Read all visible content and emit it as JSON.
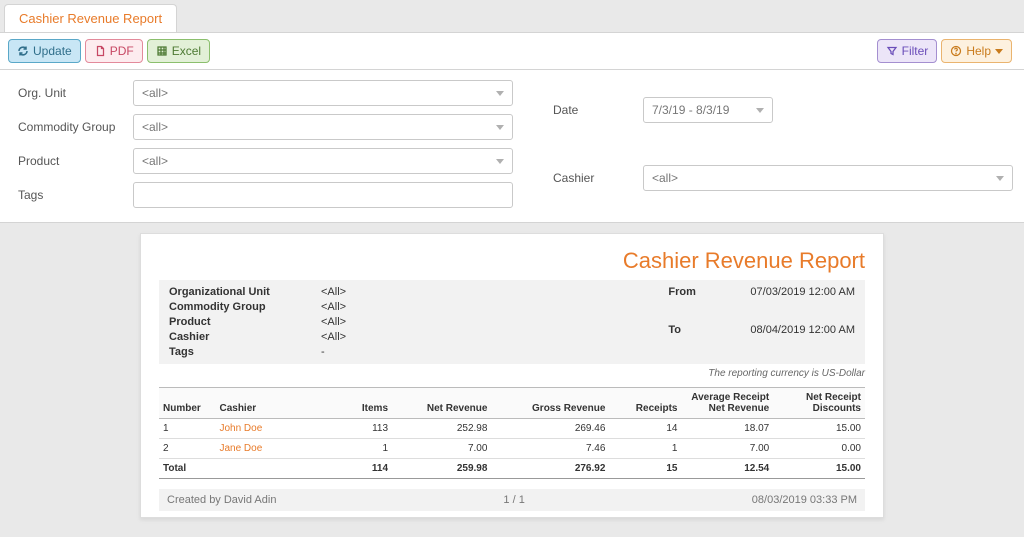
{
  "tab_title": "Cashier Revenue Report",
  "toolbar": {
    "update": "Update",
    "pdf": "PDF",
    "excel": "Excel",
    "filter": "Filter",
    "help": "Help"
  },
  "filters": {
    "org_unit_label": "Org. Unit",
    "org_unit_value": "<all>",
    "commodity_label": "Commodity Group",
    "commodity_value": "<all>",
    "product_label": "Product",
    "product_value": "<all>",
    "tags_label": "Tags",
    "tags_value": "",
    "date_label": "Date",
    "date_value": "7/3/19 - 8/3/19",
    "cashier_label": "Cashier",
    "cashier_value": "<all>"
  },
  "report": {
    "title": "Cashier Revenue Report",
    "meta": {
      "org_unit_k": "Organizational Unit",
      "org_unit_v": "<All>",
      "commodity_k": "Commodity Group",
      "commodity_v": "<All>",
      "product_k": "Product",
      "product_v": "<All>",
      "cashier_k": "Cashier",
      "cashier_v": "<All>",
      "tags_k": "Tags",
      "tags_v": "-",
      "from_k": "From",
      "from_v": "07/03/2019 12:00 AM",
      "to_k": "To",
      "to_v": "08/04/2019 12:00 AM"
    },
    "currency_note": "The reporting currency is US-Dollar",
    "columns": {
      "number": "Number",
      "cashier": "Cashier",
      "items": "Items",
      "net_rev": "Net Revenue",
      "gross_rev": "Gross Revenue",
      "receipts": "Receipts",
      "avg_receipt": "Average Receipt Net Revenue",
      "net_discounts": "Net Receipt Discounts"
    },
    "rows": [
      {
        "number": "1",
        "cashier": "John Doe",
        "items": "113",
        "net_rev": "252.98",
        "gross_rev": "269.46",
        "receipts": "14",
        "avg_receipt": "18.07",
        "net_discounts": "15.00"
      },
      {
        "number": "2",
        "cashier": "Jane Doe",
        "items": "1",
        "net_rev": "7.00",
        "gross_rev": "7.46",
        "receipts": "1",
        "avg_receipt": "7.00",
        "net_discounts": "0.00"
      }
    ],
    "total": {
      "label": "Total",
      "items": "114",
      "net_rev": "259.98",
      "gross_rev": "276.92",
      "receipts": "15",
      "avg_receipt": "12.54",
      "net_discounts": "15.00"
    },
    "footer": {
      "created_by": "Created by David Adin",
      "pages": "1  /  1",
      "timestamp": "08/03/2019 03:33 PM"
    }
  }
}
